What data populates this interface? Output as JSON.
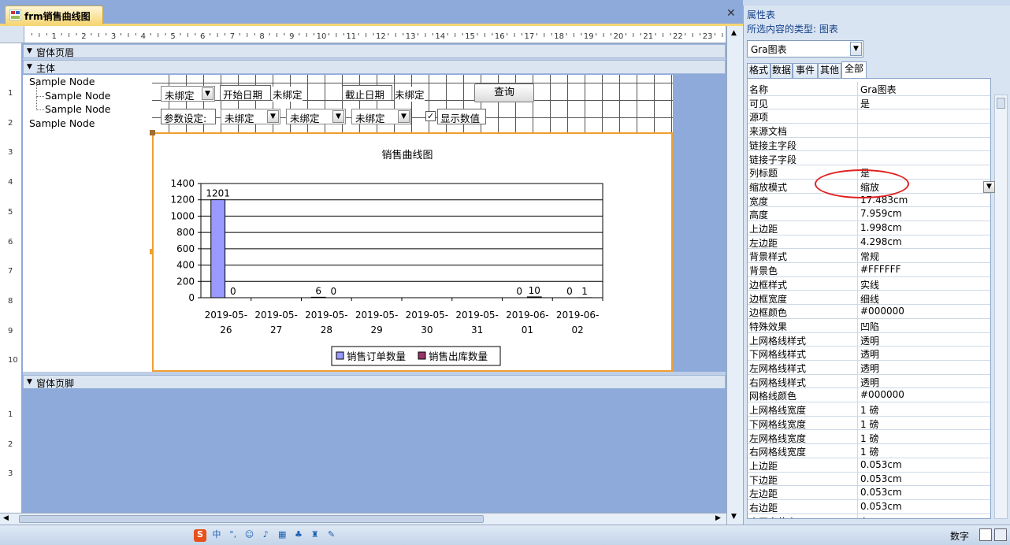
{
  "document": {
    "title": "frm销售曲线图"
  },
  "ruler": {
    "h_ticks": [
      "1",
      "2",
      "3",
      "4",
      "5",
      "6",
      "7",
      "8",
      "9",
      "10",
      "11",
      "12",
      "13",
      "14",
      "15",
      "16",
      "17",
      "18",
      "19",
      "20",
      "21",
      "22",
      "23"
    ],
    "v_ticks_detail": [
      "1",
      "2",
      "3",
      "4",
      "5",
      "6",
      "7",
      "8",
      "9",
      "10"
    ],
    "v_ticks_footer": [
      "1",
      "2",
      "3"
    ]
  },
  "sections": {
    "header": "窗体页眉",
    "detail": "主体",
    "footer": "窗体页脚"
  },
  "tree": {
    "nodes": [
      "Sample Node",
      "Sample Node",
      "Sample Node",
      "Sample Node"
    ]
  },
  "controls": {
    "combo1": "未绑定",
    "start_label": "开始日期",
    "start_value": "未绑定",
    "end_label": "截止日期",
    "end_value": "未绑定",
    "query_button": "查询",
    "param_label": "参数设定:",
    "param1": "未绑定",
    "param2": "未绑定",
    "param3": "未绑定",
    "show_values_label": "显示数值"
  },
  "chart_data": {
    "type": "bar",
    "title": "销售曲线图",
    "categories": [
      "2019-05-26",
      "2019-05-27",
      "2019-05-28",
      "2019-05-29",
      "2019-05-30",
      "2019-05-31",
      "2019-06-01",
      "2019-06-02"
    ],
    "category_lines": [
      [
        "2019-05-",
        "26"
      ],
      [
        "2019-05-",
        "27"
      ],
      [
        "2019-05-",
        "28"
      ],
      [
        "2019-05-",
        "29"
      ],
      [
        "2019-05-",
        "30"
      ],
      [
        "2019-05-",
        "31"
      ],
      [
        "2019-06-",
        "01"
      ],
      [
        "2019-06-",
        "02"
      ]
    ],
    "series": [
      {
        "name": "销售订单数量",
        "color": "#9999ff",
        "values": [
          1201,
          null,
          6,
          null,
          null,
          null,
          0,
          0
        ]
      },
      {
        "name": "销售出库数量",
        "color": "#993366",
        "values": [
          0,
          null,
          0,
          null,
          null,
          null,
          10,
          1
        ]
      }
    ],
    "yticks": [
      "0",
      "200",
      "400",
      "600",
      "800",
      "1000",
      "1200",
      "1400"
    ],
    "ylim": [
      0,
      1400
    ],
    "grid": true,
    "legend": "bottom"
  },
  "properties": {
    "title": "属性表",
    "selection_type": "所选内容的类型: 图表",
    "object": "Gra图表",
    "tabs": [
      "格式",
      "数据",
      "事件",
      "其他",
      "全部"
    ],
    "rows": [
      [
        "名称",
        "Gra图表"
      ],
      [
        "可见",
        "是"
      ],
      [
        "源项",
        ""
      ],
      [
        "来源文档",
        ""
      ],
      [
        "链接主字段",
        ""
      ],
      [
        "链接子字段",
        ""
      ],
      [
        "列标题",
        "是"
      ],
      [
        "缩放模式",
        "缩放"
      ],
      [
        "宽度",
        "17.483cm"
      ],
      [
        "高度",
        "7.959cm"
      ],
      [
        "上边距",
        "1.998cm"
      ],
      [
        "左边距",
        "4.298cm"
      ],
      [
        "背景样式",
        "常规"
      ],
      [
        "背景色",
        "#FFFFFF"
      ],
      [
        "边框样式",
        "实线"
      ],
      [
        "边框宽度",
        "细线"
      ],
      [
        "边框颜色",
        "#000000"
      ],
      [
        "特殊效果",
        "凹陷"
      ],
      [
        "上网格线样式",
        "透明"
      ],
      [
        "下网格线样式",
        "透明"
      ],
      [
        "左网格线样式",
        "透明"
      ],
      [
        "右网格线样式",
        "透明"
      ],
      [
        "网格线颜色",
        "#000000"
      ],
      [
        "上网格线宽度",
        "1 磅"
      ],
      [
        "下网格线宽度",
        "1 磅"
      ],
      [
        "左网格线宽度",
        "1 磅"
      ],
      [
        "右网格线宽度",
        "1 磅"
      ],
      [
        "上边距",
        "0.053cm"
      ],
      [
        "下边距",
        "0.053cm"
      ],
      [
        "左边距",
        "0.053cm"
      ],
      [
        "右边距",
        "0.053cm"
      ],
      [
        "水平定位点",
        "左"
      ]
    ]
  },
  "statusbar": {
    "mode": "数字",
    "ime_letter": "S",
    "ime_lang": "中"
  },
  "colors": {
    "accent": "#f0a030",
    "annotation": "#e02020"
  }
}
